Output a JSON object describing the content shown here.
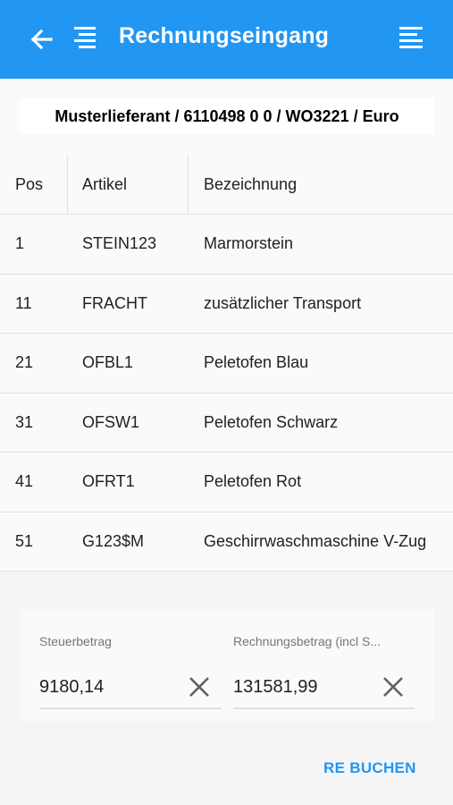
{
  "appbar": {
    "title": "Rechnungseingang",
    "icons": [
      "arrow-left-icon",
      "list-lines-icon",
      "menu-lines-icon"
    ],
    "color": "#2196f3"
  },
  "supplier": {
    "text": "Musterlieferant / 6110498 0 0 / WO3221 / Euro"
  },
  "table": {
    "headers": [
      "Pos",
      "Artikel",
      "Bezeichnung"
    ],
    "rows": [
      {
        "pos": "1",
        "artikel": "STEIN123",
        "bezeichnung": "Marmorstein"
      },
      {
        "pos": "11",
        "artikel": "FRACHT",
        "bezeichnung": "zusätzlicher Transport"
      },
      {
        "pos": "21",
        "artikel": "OFBL1",
        "bezeichnung": "Peletofen Blau"
      },
      {
        "pos": "31",
        "artikel": "OFSW1",
        "bezeichnung": "Peletofen Schwarz"
      },
      {
        "pos": "41",
        "artikel": "OFRT1",
        "bezeichnung": "Peletofen Rot"
      },
      {
        "pos": "51",
        "artikel": "G123$M",
        "bezeichnung": "Geschirrwaschmaschine V-Zug"
      }
    ]
  },
  "footer": {
    "steuer_label": "Steuerbetrag",
    "steuer_value": "9180,14",
    "rechnung_label": "Rechnungsbetrag (incl S...",
    "rechnung_value": "131581,99",
    "button_label": "RE BUCHEN"
  }
}
